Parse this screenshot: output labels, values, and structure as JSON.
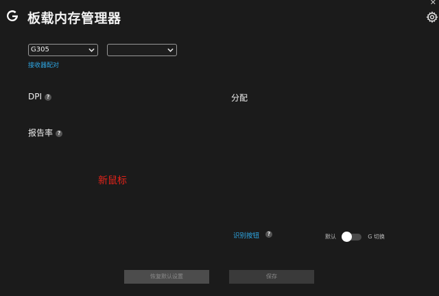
{
  "header": {
    "title": "板载内存管理器",
    "close_glyph": "✕"
  },
  "device_select": {
    "selected": "G305"
  },
  "secondary_select": {
    "selected": ""
  },
  "receiver_pairing_link": "接收器配对",
  "sections": {
    "dpi_label": "DPI",
    "assignment_label": "分配",
    "report_rate_label": "报告率"
  },
  "help_glyph": "?",
  "status_message": "新鼠标",
  "identify_buttons_link": "识别按钮",
  "mode_toggle": {
    "left_label": "默认",
    "right_label": "G 切换",
    "state": "default"
  },
  "footer": {
    "reset_label": "恢复默认设置",
    "save_label": "保存"
  },
  "colors": {
    "background": "#1b1b1b",
    "link": "#2ea8e6",
    "alert": "#e2231a"
  },
  "icons": [
    "logitech-g-logo",
    "close-icon",
    "gear-icon",
    "chevron-down-icon",
    "help-icon"
  ]
}
